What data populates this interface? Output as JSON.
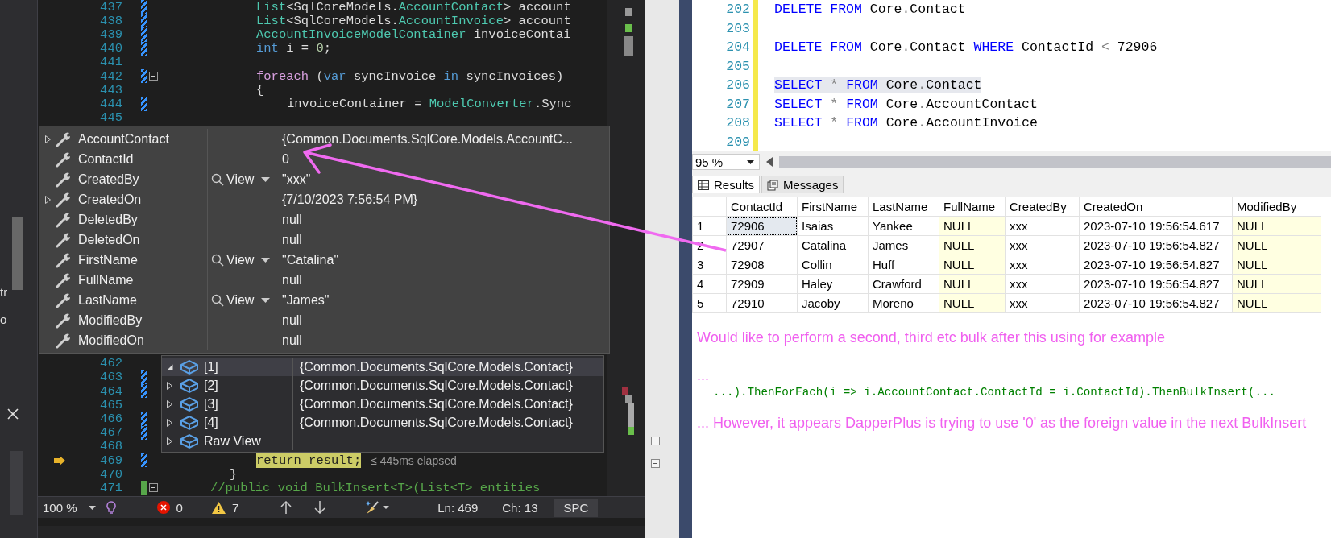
{
  "side_panel": {
    "texts": [
      "tr",
      "o"
    ]
  },
  "editor": {
    "lines_top": [
      {
        "number": "437",
        "kind": "body",
        "edited": true,
        "saved": false,
        "current": false,
        "foldable": false,
        "segments": [
          {
            "text": "List",
            "kind": "type"
          },
          {
            "text": "<SqlCoreModels.",
            "kind": "plain"
          },
          {
            "text": "AccountContact",
            "kind": "type"
          },
          {
            "text": "> account",
            "kind": "plain"
          }
        ]
      },
      {
        "number": "438",
        "kind": "body",
        "edited": true,
        "saved": false,
        "current": false,
        "foldable": false,
        "segments": [
          {
            "text": "List",
            "kind": "type"
          },
          {
            "text": "<SqlCoreModels.",
            "kind": "plain"
          },
          {
            "text": "AccountInvoice",
            "kind": "type"
          },
          {
            "text": "> account",
            "kind": "plain"
          }
        ]
      },
      {
        "number": "439",
        "kind": "body",
        "edited": true,
        "saved": false,
        "current": false,
        "foldable": false,
        "segments": [
          {
            "text": "AccountInvoiceModelContainer",
            "kind": "type"
          },
          {
            "text": " invoiceContai",
            "kind": "plain"
          }
        ]
      },
      {
        "number": "440",
        "kind": "body",
        "edited": true,
        "saved": false,
        "current": false,
        "foldable": false,
        "segments": [
          {
            "text": "int",
            "kind": "keyword"
          },
          {
            "text": " i = ",
            "kind": "plain"
          },
          {
            "text": "0",
            "kind": "number"
          },
          {
            "text": ";",
            "kind": "plain"
          }
        ]
      },
      {
        "number": "441",
        "kind": "body",
        "edited": false,
        "saved": false,
        "current": false,
        "foldable": false
      },
      {
        "number": "442",
        "kind": "body",
        "edited": true,
        "saved": false,
        "current": false,
        "foldable": true,
        "segments": [
          {
            "text": "foreach",
            "kind": "control"
          },
          {
            "text": " (",
            "kind": "plain"
          },
          {
            "text": "var",
            "kind": "keyword"
          },
          {
            "text": " syncInvoice ",
            "kind": "plain"
          },
          {
            "text": "in",
            "kind": "keyword"
          },
          {
            "text": " syncInvoices)",
            "kind": "plain"
          }
        ]
      },
      {
        "number": "443",
        "kind": "body",
        "edited": false,
        "saved": false,
        "current": false,
        "foldable": false,
        "segments": [
          {
            "text": "{",
            "kind": "plain"
          }
        ]
      },
      {
        "number": "444",
        "kind": "loop",
        "edited": true,
        "saved": false,
        "current": false,
        "foldable": false,
        "segments": [
          {
            "text": "invoiceContainer = ",
            "kind": "plain"
          },
          {
            "text": "ModelConverter",
            "kind": "type"
          },
          {
            "text": ".Sync",
            "kind": "plain"
          }
        ]
      },
      {
        "number": "445",
        "kind": "loop",
        "edited": false,
        "saved": false,
        "current": false,
        "foldable": false
      }
    ],
    "lines_bottom": [
      {
        "number": "462",
        "kind": "body",
        "edited": false,
        "saved": false,
        "current": false,
        "foldable": false
      },
      {
        "number": "463",
        "kind": "body",
        "edited": true,
        "saved": false,
        "current": false,
        "foldable": false
      },
      {
        "number": "464",
        "kind": "body",
        "edited": true,
        "saved": false,
        "current": false,
        "foldable": false
      },
      {
        "number": "465",
        "kind": "body",
        "edited": false,
        "saved": false,
        "current": false,
        "foldable": false
      },
      {
        "number": "466",
        "kind": "body",
        "edited": true,
        "saved": false,
        "current": false,
        "foldable": false
      },
      {
        "number": "467",
        "kind": "body",
        "edited": true,
        "saved": false,
        "current": false,
        "foldable": false
      },
      {
        "number": "468",
        "kind": "body",
        "edited": false,
        "saved": false,
        "current": false,
        "foldable": false
      },
      {
        "number": "469",
        "kind": "body",
        "edited": true,
        "saved": false,
        "current": true,
        "foldable": false,
        "segments": [
          {
            "text": "return result;",
            "kind": "current"
          }
        ],
        "hint": "≤ 445ms elapsed"
      },
      {
        "number": "470",
        "kind": "method",
        "edited": false,
        "saved": false,
        "current": false,
        "foldable": false,
        "segments": [
          {
            "text": "}",
            "kind": "plain"
          }
        ]
      },
      {
        "number": "471",
        "kind": "class",
        "edited": false,
        "saved": true,
        "current": false,
        "foldable": true,
        "segments": [
          {
            "text": "//public void BulkInsert<T>(List<T> entities",
            "kind": "comment"
          }
        ]
      }
    ]
  },
  "datatip": {
    "rows": [
      {
        "name": "AccountContact",
        "expandable": true,
        "value": "{Common.Documents.SqlCore.Models.AccountC..."
      },
      {
        "name": "ContactId",
        "expandable": false,
        "value": "0"
      },
      {
        "name": "CreatedBy",
        "expandable": false,
        "view_label": "View",
        "value": "\"xxx\""
      },
      {
        "name": "CreatedOn",
        "expandable": true,
        "value": "{7/10/2023 7:56:54 PM}"
      },
      {
        "name": "DeletedBy",
        "expandable": false,
        "value": "null"
      },
      {
        "name": "DeletedOn",
        "expandable": false,
        "value": "null"
      },
      {
        "name": "FirstName",
        "expandable": false,
        "view_label": "View",
        "value": "\"Catalina\""
      },
      {
        "name": "FullName",
        "expandable": false,
        "value": "null"
      },
      {
        "name": "LastName",
        "expandable": false,
        "view_label": "View",
        "value": "\"James\""
      },
      {
        "name": "ModifiedBy",
        "expandable": false,
        "value": "null"
      },
      {
        "name": "ModifiedOn",
        "expandable": false,
        "value": "null"
      }
    ]
  },
  "list_tip": {
    "rows": [
      {
        "label": "[1]",
        "expanded": true,
        "selected": true,
        "value": "{Common.Documents.SqlCore.Models.Contact}"
      },
      {
        "label": "[2]",
        "expanded": false,
        "selected": false,
        "value": "{Common.Documents.SqlCore.Models.Contact}"
      },
      {
        "label": "[3]",
        "expanded": false,
        "selected": false,
        "value": "{Common.Documents.SqlCore.Models.Contact}"
      },
      {
        "label": "[4]",
        "expanded": false,
        "selected": false,
        "value": "{Common.Documents.SqlCore.Models.Contact}"
      },
      {
        "label": "Raw View",
        "expanded": false,
        "selected": false
      }
    ]
  },
  "status_bar": {
    "zoom": "100 %",
    "errors": "0",
    "warnings": "7",
    "line": "Ln: 469",
    "column": "Ch: 13",
    "whitespace": "SPC"
  },
  "sql_editor": {
    "lines": [
      {
        "number": "202",
        "selected": false,
        "segments": [
          {
            "text": "DELETE FROM",
            "kind": "keyword"
          },
          {
            "text": " Core",
            "kind": "name"
          },
          {
            "text": ".",
            "kind": "operator"
          },
          {
            "text": "Contact",
            "kind": "name"
          }
        ]
      },
      {
        "number": "203",
        "selected": false
      },
      {
        "number": "204",
        "selected": false,
        "segments": [
          {
            "text": "DELETE FROM",
            "kind": "keyword"
          },
          {
            "text": " Core",
            "kind": "name"
          },
          {
            "text": ".",
            "kind": "operator"
          },
          {
            "text": "Contact ",
            "kind": "name"
          },
          {
            "text": "WHERE",
            "kind": "keyword"
          },
          {
            "text": " ContactId ",
            "kind": "name"
          },
          {
            "text": "<",
            "kind": "operator"
          },
          {
            "text": " 72906",
            "kind": "name"
          }
        ]
      },
      {
        "number": "205",
        "selected": false
      },
      {
        "number": "206",
        "selected": true,
        "segments": [
          {
            "text": "SELECT",
            "kind": "keyword"
          },
          {
            "text": " *",
            "kind": "operator"
          },
          {
            "text": " FROM",
            "kind": "keyword"
          },
          {
            "text": " Core",
            "kind": "name"
          },
          {
            "text": ".",
            "kind": "operator"
          },
          {
            "text": "Contact",
            "kind": "name"
          }
        ]
      },
      {
        "number": "207",
        "selected": false,
        "segments": [
          {
            "text": "SELECT",
            "kind": "keyword"
          },
          {
            "text": " *",
            "kind": "operator"
          },
          {
            "text": " FROM",
            "kind": "keyword"
          },
          {
            "text": " Core",
            "kind": "name"
          },
          {
            "text": ".",
            "kind": "operator"
          },
          {
            "text": "AccountContact",
            "kind": "name"
          }
        ]
      },
      {
        "number": "208",
        "selected": false,
        "segments": [
          {
            "text": "SELECT",
            "kind": "keyword"
          },
          {
            "text": " *",
            "kind": "operator"
          },
          {
            "text": " FROM",
            "kind": "keyword"
          },
          {
            "text": " Core",
            "kind": "name"
          },
          {
            "text": ".",
            "kind": "operator"
          },
          {
            "text": "AccountInvoice",
            "kind": "name"
          }
        ]
      },
      {
        "number": "209",
        "selected": false
      }
    ],
    "zoom": "95 %"
  },
  "result_tabs": [
    {
      "label": "Results",
      "selected": true
    },
    {
      "label": "Messages",
      "selected": false
    }
  ],
  "grid": {
    "columns": [
      {
        "label": "ContactId",
        "highlighted": false
      },
      {
        "label": "FirstName",
        "highlighted": false
      },
      {
        "label": "LastName",
        "highlighted": false
      },
      {
        "label": "FullName",
        "highlighted": true
      },
      {
        "label": "CreatedBy",
        "highlighted": false
      },
      {
        "label": "CreatedOn",
        "highlighted": false
      },
      {
        "label": "ModifiedBy",
        "highlighted": true
      }
    ],
    "rows": [
      {
        "number": "1",
        "focused": true,
        "cells": [
          "72906",
          "Isaias",
          "Yankee",
          "NULL",
          "xxx",
          "2023-07-10 19:56:54.617",
          "NULL"
        ]
      },
      {
        "number": "2",
        "focused": false,
        "cells": [
          "72907",
          "Catalina",
          "James",
          "NULL",
          "xxx",
          "2023-07-10 19:56:54.827",
          "NULL"
        ]
      },
      {
        "number": "3",
        "focused": false,
        "cells": [
          "72908",
          "Collin",
          "Huff",
          "NULL",
          "xxx",
          "2023-07-10 19:56:54.827",
          "NULL"
        ]
      },
      {
        "number": "4",
        "focused": false,
        "cells": [
          "72909",
          "Haley",
          "Crawford",
          "NULL",
          "xxx",
          "2023-07-10 19:56:54.827",
          "NULL"
        ]
      },
      {
        "number": "5",
        "focused": false,
        "cells": [
          "72910",
          "Jacoby",
          "Moreno",
          "NULL",
          "xxx",
          "2023-07-10 19:56:54.827",
          "NULL"
        ]
      }
    ]
  },
  "notes": [
    {
      "kind": "text",
      "text": "Would like to perform a second, third etc bulk after this using for example"
    },
    {
      "kind": "text",
      "text": "..."
    },
    {
      "kind": "code",
      "text": "...).ThenForEach(i => i.AccountContact.ContactId = i.ContactId).ThenBulkInsert(..."
    },
    {
      "kind": "text",
      "text": "... However, it appears DapperPlus is trying to use '0' as the foreign value in the next BulkInsert"
    }
  ]
}
